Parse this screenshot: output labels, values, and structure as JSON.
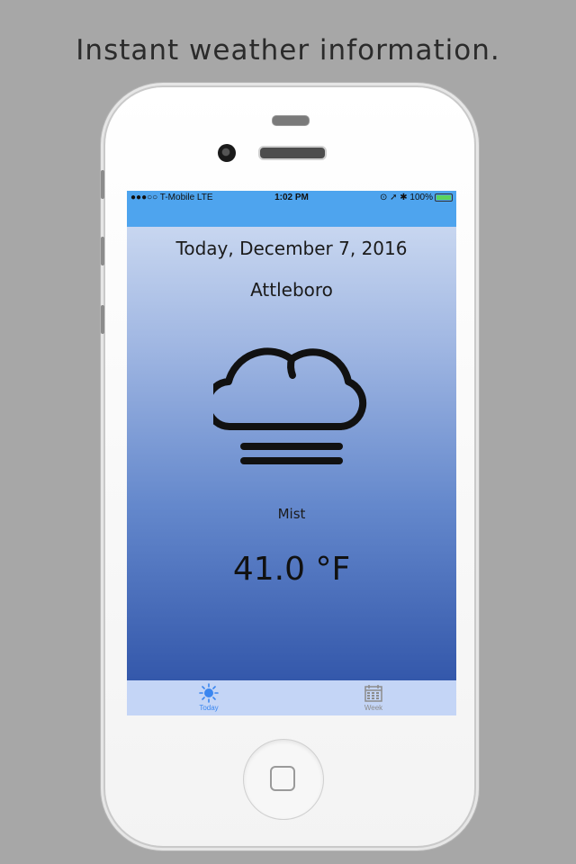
{
  "caption": "Instant weather information.",
  "status_bar": {
    "carrier": "●●●○○ T-Mobile   LTE",
    "time": "1:02 PM",
    "right": "⊙ ➚ ✱ 100%"
  },
  "weather": {
    "date_line": "Today, December 7, 2016",
    "city": "Attleboro",
    "icon": "mist-cloud-icon",
    "condition": "Mist",
    "temperature": "41.0 °F"
  },
  "tabs": [
    {
      "label": "Today",
      "icon": "sun-icon",
      "active": true
    },
    {
      "label": "Week",
      "icon": "calendar-icon",
      "active": false
    }
  ],
  "colors": {
    "accent": "#3a86f0",
    "status_bar": "#4ea4ee",
    "gradient_top": "#d4e0f4",
    "gradient_bottom": "#2a4ea4"
  }
}
